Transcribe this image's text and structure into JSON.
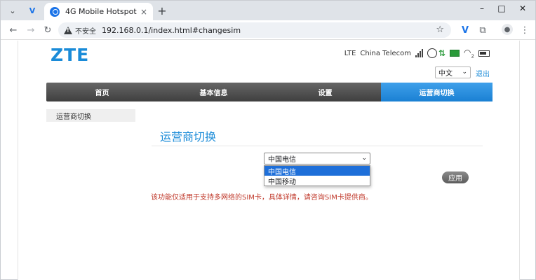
{
  "browser": {
    "tab_title": "4G Mobile Hotspot",
    "tab_close": "×",
    "new_tab": "+",
    "minimize": "–",
    "maximize": "□",
    "close": "✕",
    "insecure_label": "不安全",
    "url": "192.168.0.1/index.html#changesim"
  },
  "header": {
    "logo": "ZTE",
    "network_type": "LTE",
    "carrier": "China Telecom",
    "wifi_clients": "2",
    "language_selected": "中文",
    "logout": "退出"
  },
  "nav": {
    "items": [
      {
        "label": "首页"
      },
      {
        "label": "基本信息"
      },
      {
        "label": "设置"
      },
      {
        "label": "运营商切换"
      }
    ]
  },
  "sidebar": {
    "items": [
      {
        "label": "运营商切换"
      }
    ]
  },
  "main": {
    "title": "运营商切换",
    "operator_selected": "中国电信",
    "operator_options": [
      "中国电信",
      "中国移动"
    ],
    "apply_label": "应用",
    "note": "该功能仅适用于支持多网络的SIM卡，具体详情，请咨询SIM卡提供商。"
  },
  "colors": {
    "accent": "#1a8bd8",
    "nav_active": "#1a80d3",
    "note": "#c0392b"
  }
}
